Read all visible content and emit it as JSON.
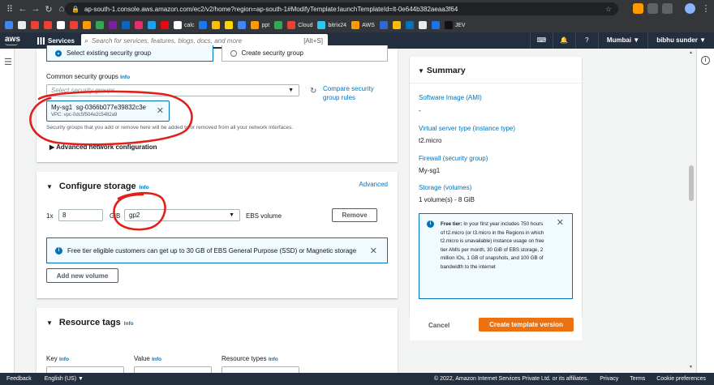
{
  "browser": {
    "url": "ap-south-1.console.aws.amazon.com/ec2/v2/home?region=ap-south-1#ModifyTemplate:launchTemplateId=lt-0e644b382aeaa3f64",
    "bookmarks": [
      "calc",
      "ppt",
      "Cloud",
      "bitrix24",
      "AWS",
      "JEV"
    ]
  },
  "awsnav": {
    "logo": "aws",
    "services": "Services",
    "search_placeholder": "Search for services, features, blogs, docs, and more",
    "search_shortcut": "[Alt+S]",
    "region": "Mumbai ▼",
    "user": "bibhu sunder ▼"
  },
  "security": {
    "option_existing": "Select existing security group",
    "option_create": "Create security group",
    "common_label": "Common security groups",
    "info": "Info",
    "select_placeholder": "Select security groups",
    "compare_link": "Compare security group rules",
    "token_name": "My-sg1",
    "token_id": "sg-0366b077e39832c3e",
    "token_vpc": "VPC: vpc-0dc5f504e2c5482a9",
    "hint": "Security groups that you add or remove here will be added to or removed from all your network interfaces.",
    "advanced_network": "Advanced network configuration"
  },
  "storage": {
    "title": "Configure storage",
    "info": "Info",
    "advanced": "Advanced",
    "prefix": "1x",
    "size": "8",
    "unit": "GiB",
    "volume_type": "gp2",
    "volume_label": "EBS volume",
    "remove": "Remove",
    "alert": "Free tier eligible customers can get up to 30 GB of EBS General Purpose (SSD) or Magnetic storage",
    "add_volume": "Add new volume"
  },
  "tags": {
    "title": "Resource tags",
    "info": "Info",
    "col_key": "Key",
    "col_value": "Value",
    "col_types": "Resource types"
  },
  "summary": {
    "title": "Summary",
    "ami_label": "Software Image (AMI)",
    "ami_value": "-",
    "type_label": "Virtual server type (instance type)",
    "type_value": "t2.micro",
    "fw_label": "Firewall (security group)",
    "fw_value": "My-sg1",
    "storage_label": "Storage (volumes)",
    "storage_value": "1 volume(s) - 8 GiB",
    "free_tier_bold": "Free tier:",
    "free_tier_text": "In your first year includes 750 hours of t2.micro (or t3.micro in the Regions in which t2.micro is unavailable) instance usage on free tier AMIs per month, 30 GiB of EBS storage, 2 million IOs, 1 GB of snapshots, and 100 GB of bandwidth to the internet",
    "cancel": "Cancel",
    "create": "Create template version"
  },
  "footer": {
    "feedback": "Feedback",
    "language": "English (US) ▼",
    "copyright": "© 2022, Amazon Internet Services Private Ltd. or its affiliates.",
    "privacy": "Privacy",
    "terms": "Terms",
    "cookies": "Cookie preferences"
  },
  "colors": {
    "accent": "#0073bb",
    "primary_button": "#ec7211",
    "annotation": "#e0201b",
    "nav": "#232f3e"
  }
}
